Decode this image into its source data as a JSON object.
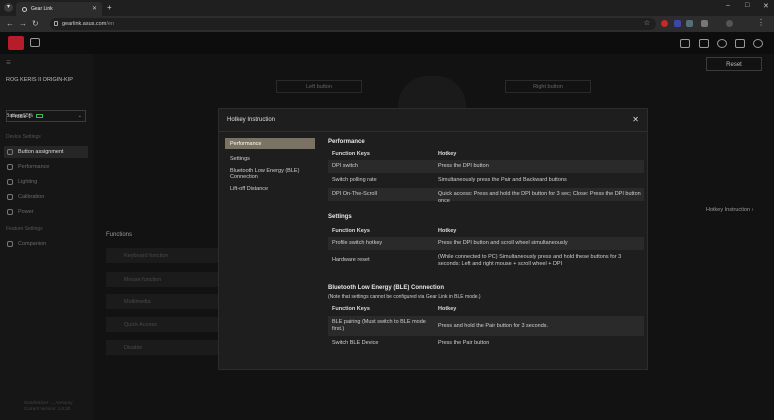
{
  "browser": {
    "tab_title": "Gear Link",
    "url_host": "gearlink.asus.com",
    "url_path": "/en"
  },
  "app": {
    "device_name": "ROG KERIS II ORIGIN-KIP",
    "battery": "Battery 55%",
    "profile": "Profile 1",
    "device_settings_label": "Device Settings",
    "other_features_label": "Feature Settings",
    "nav": [
      {
        "label": "Button assignment"
      },
      {
        "label": "Performance"
      },
      {
        "label": "Lighting"
      },
      {
        "label": "Calibration"
      },
      {
        "label": "Power"
      }
    ],
    "companion": "Companion",
    "reset": "Reset",
    "left_button": "Left button",
    "right_button": "Right button",
    "functions_title": "Functions",
    "functions": [
      "Keyboard function",
      "Mouse function",
      "Multimedia",
      "Quick Access",
      "Disable"
    ],
    "hotkey_instruction": "Hotkey Instruction",
    "version": [
      "Gearlink/ver ..., Armoury",
      "Current Version: 1.0.20"
    ]
  },
  "modal": {
    "title": "Hotkey Instruction",
    "nav": [
      "Performance",
      "Settings",
      "Bluetooth Low Energy (BLE) Connection",
      "Lift-off Distance"
    ],
    "col_key": "Function Keys",
    "col_hotkey": "Hotkey",
    "sections": [
      {
        "title": "Performance",
        "rows": [
          [
            "DPI switch",
            "Press the DPI button"
          ],
          [
            "Switch polling rate",
            "Simultaneously press the Pair and Backward buttons"
          ],
          [
            "DPI On-The-Scroll",
            "Quick access: Press and hold the DPI button for 3 sec; Close: Press the DPI button once"
          ]
        ]
      },
      {
        "title": "Settings",
        "rows": [
          [
            "Profile switch hotkey",
            "Press the DPI button and scroll wheel simultaneously"
          ],
          [
            "Hardware reset",
            "(While connected to PC) Simultaneously press and hold these buttons for 3 seconds: Left and right mouse + scroll wheel + DPI"
          ]
        ]
      },
      {
        "title": "Bluetooth Low Energy (BLE) Connection",
        "note": "(Note that settings cannot be configured via Gear Link in BLE mode.)",
        "rows": [
          [
            "BLE pairing (Must switch to BLE mode first.)",
            "Press and hold the Pair button for 3 seconds."
          ],
          [
            "Switch BLE Device",
            "Press the Pair button"
          ]
        ]
      }
    ]
  }
}
